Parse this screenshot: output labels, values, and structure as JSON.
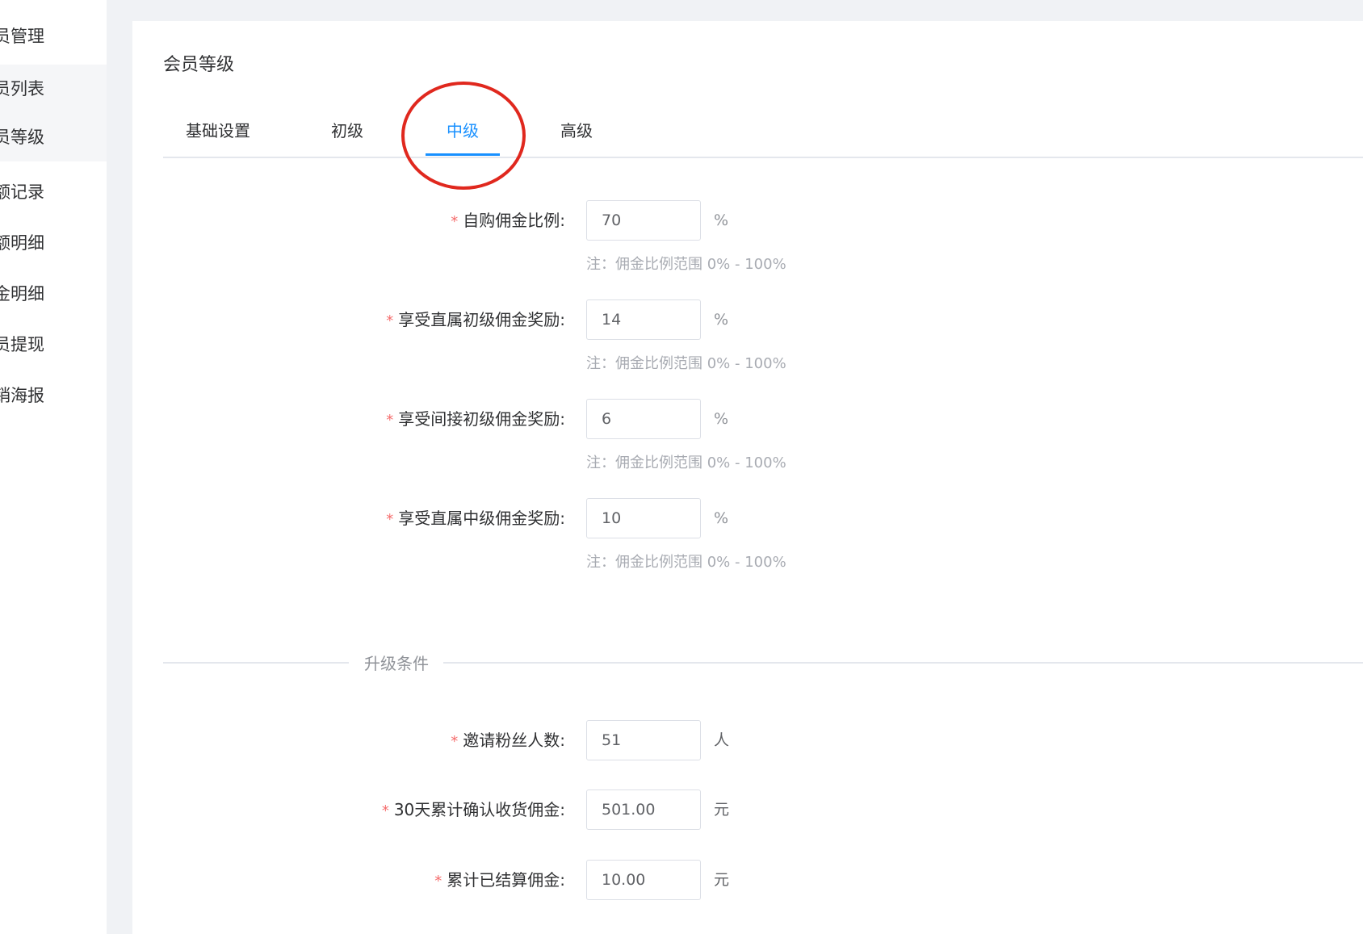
{
  "sidebar": {
    "items": [
      {
        "label": "员管理"
      },
      {
        "label": "员列表"
      },
      {
        "label": "员等级"
      },
      {
        "label": "额记录"
      },
      {
        "label": "额明细"
      },
      {
        "label": "金明细"
      },
      {
        "label": "员提现"
      },
      {
        "label": "销海报"
      }
    ]
  },
  "page": {
    "title": "会员等级"
  },
  "tabs": [
    {
      "label": "基础设置"
    },
    {
      "label": "初级"
    },
    {
      "label": "中级"
    },
    {
      "label": "高级"
    }
  ],
  "active_tab": "中级",
  "commission": {
    "rows": [
      {
        "label": "自购佣金比例:",
        "value": "70",
        "unit": "%",
        "hint": "注：佣金比例范围 0% - 100%"
      },
      {
        "label": "享受直属初级佣金奖励:",
        "value": "14",
        "unit": "%",
        "hint": "注：佣金比例范围 0% - 100%"
      },
      {
        "label": "享受间接初级佣金奖励:",
        "value": "6",
        "unit": "%",
        "hint": "注：佣金比例范围 0% - 100%"
      },
      {
        "label": "享受直属中级佣金奖励:",
        "value": "10",
        "unit": "%",
        "hint": "注：佣金比例范围 0% - 100%"
      }
    ]
  },
  "upgrade": {
    "section_title": "升级条件",
    "rows": [
      {
        "label": "邀请粉丝人数:",
        "value": "51",
        "unit": "人"
      },
      {
        "label": "30天累计确认收货佣金:",
        "value": "501.00",
        "unit": "元"
      },
      {
        "label": "累计已结算佣金:",
        "value": "10.00",
        "unit": "元"
      }
    ]
  },
  "required_mark": "*",
  "colors": {
    "accent": "#1890ff",
    "required": "#f56c6c",
    "annotation": "#e0281e",
    "workspace_bg": "#f0f2f5"
  }
}
